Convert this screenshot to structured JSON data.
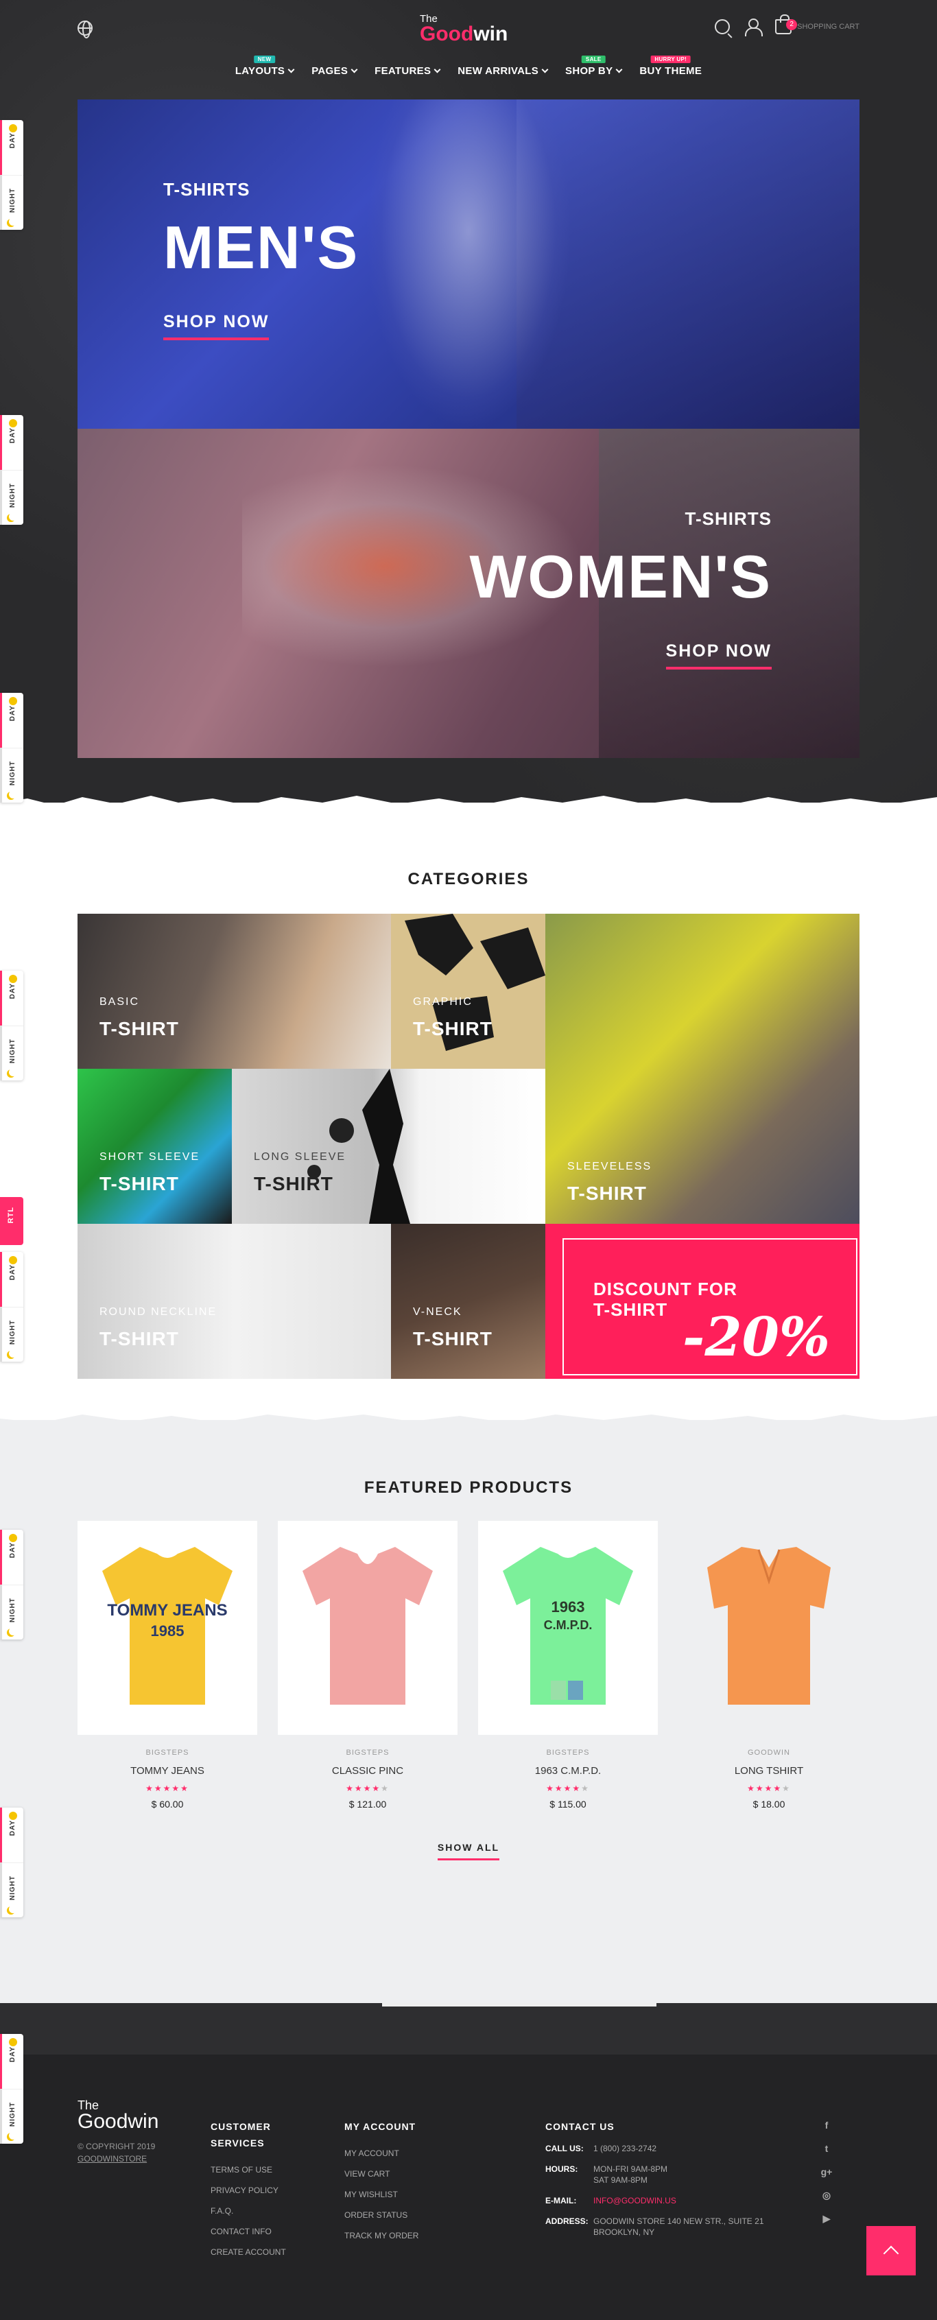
{
  "header": {
    "logo_the": "The",
    "logo_g": "Good",
    "logo_rest": "win",
    "cart_label": "SHOPPING CART",
    "cart_count": "2"
  },
  "nav": [
    {
      "label": "LAYOUTS",
      "tag": "NEW",
      "dropdown": true
    },
    {
      "label": "PAGES",
      "tag": "",
      "dropdown": true
    },
    {
      "label": "FEATURES",
      "tag": "",
      "dropdown": true
    },
    {
      "label": "NEW ARRIVALS",
      "tag": "",
      "dropdown": true
    },
    {
      "label": "SHOP BY",
      "tag": "SALE",
      "dropdown": true
    },
    {
      "label": "BUY THEME",
      "tag": "HURRY UP!",
      "dropdown": false
    }
  ],
  "banners": [
    {
      "sub": "T-SHIRTS",
      "title": "MEN'S",
      "link": "SHOP NOW"
    },
    {
      "sub": "T-SHIRTS",
      "title": "WOMEN'S",
      "link": "SHOP NOW"
    }
  ],
  "day_night": {
    "day": "DAY",
    "night": "NIGHT",
    "rtl": "RTL"
  },
  "categories": {
    "title": "CATEGORIES",
    "items": [
      {
        "sub": "BASIC",
        "title": "T-SHIRT"
      },
      {
        "sub": "GRAPHIC",
        "title": "T-SHIRT"
      },
      {
        "sub": "SLEEVELESS",
        "title": "T-SHIRT"
      },
      {
        "sub": "SHORT SLEEVE",
        "title": "T-SHIRT"
      },
      {
        "sub": "LONG SLEEVE",
        "title": "T-SHIRT"
      },
      {
        "sub": "ROUND NECKLINE",
        "title": "T-SHIRT"
      },
      {
        "sub": "V-NECK",
        "title": "T-SHIRT"
      }
    ],
    "discount": {
      "line1": "DISCOUNT FOR",
      "line2": "T-SHIRT",
      "amount": "-20%"
    }
  },
  "featured": {
    "title": "FEATURED PRODUCTS",
    "show_all": "SHOW ALL",
    "products": [
      {
        "brand": "BIGSTEPS",
        "name": "TOMMY JEANS",
        "price": "$ 60.00",
        "stars": 5,
        "color": "#f6c531"
      },
      {
        "brand": "BIGSTEPS",
        "name": "CLASSIC PINC",
        "price": "$ 121.00",
        "stars": 4,
        "color": "#f2a5a3"
      },
      {
        "brand": "BIGSTEPS",
        "name": "1963 C.M.P.D.",
        "price": "$ 115.00",
        "stars": 4,
        "color": "#7cf09a"
      },
      {
        "brand": "GOODWIN",
        "name": "LONG TSHIRT",
        "price": "$ 18.00",
        "stars": 4,
        "color": "#f5964f"
      }
    ]
  },
  "footer": {
    "logo_the": "The",
    "logo_name": "Goodwin",
    "copyright": "© COPYRIGHT 2019",
    "copyright_link": "GOODWINSTORE",
    "customer_services": {
      "title_1": "CUSTOMER",
      "title_2": "SERVICES",
      "links": [
        "TERMS OF USE",
        "PRIVACY POLICY",
        "F.A.Q.",
        "CONTACT INFO",
        "CREATE ACCOUNT"
      ]
    },
    "my_account": {
      "title": "MY ACCOUNT",
      "links": [
        "MY ACCOUNT",
        "VIEW CART",
        "MY WISHLIST",
        "ORDER STATUS",
        "TRACK MY ORDER"
      ]
    },
    "contact": {
      "title": "CONTACT US",
      "call_label": "CALL US:",
      "call": "1 (800) 233-2742",
      "hours_label": "HOURS:",
      "hours_1": "MON-FRI 9AM-8PM",
      "hours_2": "SAT 9AM-8PM",
      "email_label": "E-MAIL:",
      "email": "INFO@GOODWIN.US",
      "address_label": "ADDRESS:",
      "address": "GOODWIN STORE 140 NEW STR., SUITE 21 BROOKLYN, NY"
    },
    "social": [
      "facebook-icon",
      "twitter-icon",
      "google-plus-icon",
      "instagram-icon",
      "youtube-icon"
    ]
  },
  "colors": {
    "accent": "#ff2d6b",
    "dark": "#2a2a2c"
  }
}
